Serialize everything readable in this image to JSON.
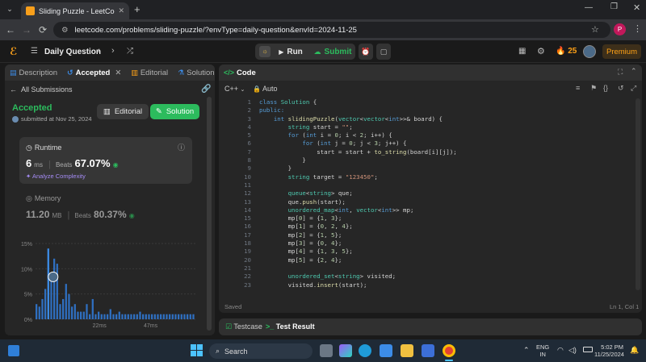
{
  "browser": {
    "tab_title": "Sliding Puzzle - LeetCode",
    "url": "leetcode.com/problems/sliding-puzzle/?envType=daily-question&envId=2024-11-25",
    "profile_initial": "P"
  },
  "header": {
    "daily_question": "Daily Question",
    "run": "Run",
    "submit": "Submit",
    "streak": "25",
    "premium": "Premium"
  },
  "left": {
    "tabs": [
      "Description",
      "Accepted",
      "Editorial",
      "Solutions"
    ],
    "all_submissions": "All Submissions",
    "status": "Accepted",
    "submitted": "submitted at Nov 25, 2024",
    "editorial_btn": "Editorial",
    "solution_btn": "Solution",
    "runtime_label": "Runtime",
    "runtime_value": "6",
    "runtime_unit": "ms",
    "runtime_beats_label": "Beats",
    "runtime_beats": "67.07%",
    "analyze": "Analyze Complexity",
    "memory_label": "Memory",
    "memory_value": "11.20",
    "memory_unit": "MB",
    "memory_beats_label": "Beats",
    "memory_beats": "80.37%"
  },
  "chart_data": {
    "type": "bar",
    "yticks": [
      "15%",
      "10%",
      "5%",
      "0%"
    ],
    "xticks": [
      "22ms",
      "47ms"
    ],
    "ylim": [
      0,
      15
    ],
    "values": [
      3,
      2.5,
      4,
      6,
      14,
      9,
      12,
      11,
      3,
      4,
      7,
      5,
      2.5,
      3,
      1.5,
      1.5,
      1.5,
      3,
      1,
      4,
      1,
      1.5,
      1,
      1,
      1,
      2,
      1,
      1,
      1.5,
      1,
      1,
      1,
      1,
      1,
      1,
      1.5,
      1,
      1,
      1,
      1,
      1,
      1,
      1,
      1,
      1,
      1,
      1,
      1,
      1,
      1,
      1,
      1,
      1,
      1
    ],
    "highlight_index": 4
  },
  "code": {
    "title": "Code",
    "language": "C++",
    "mode": "Auto",
    "lines": [
      [
        "kw",
        "class ",
        "ty",
        "Solution",
        "",
        " {"
      ],
      [
        "kw",
        "public:"
      ],
      [
        "",
        "    ",
        "kw",
        "int ",
        "fn",
        "slidingPuzzle",
        "",
        "(",
        "ty",
        "vector",
        "",
        "<",
        "ty",
        "vector",
        "",
        "<",
        "kw",
        "int",
        "",
        ">>& board) {"
      ],
      [
        "",
        "        ",
        "ty",
        "string",
        "",
        " start = ",
        "st",
        "\"\"",
        "",
        ";"
      ],
      [
        "",
        "        ",
        "kw",
        "for ",
        "",
        "(",
        "kw",
        "int",
        "",
        " i = ",
        "nm",
        "0",
        "",
        "; i < ",
        "nm",
        "2",
        "",
        "; i++) {"
      ],
      [
        "",
        "            ",
        "kw",
        "for ",
        "",
        "(",
        "kw",
        "int",
        "",
        " j = ",
        "nm",
        "0",
        "",
        "; j < ",
        "nm",
        "3",
        "",
        "; j++) {"
      ],
      [
        "",
        "                start = start + ",
        "fn",
        "to_string",
        "",
        "(board[i][j]);"
      ],
      [
        "",
        "            }"
      ],
      [
        "",
        "        }"
      ],
      [
        "",
        "        ",
        "ty",
        "string",
        "",
        " target = ",
        "st",
        "\"123450\"",
        "",
        ";"
      ],
      [
        "",
        ""
      ],
      [
        "",
        "        ",
        "ty",
        "queue",
        "",
        "<",
        "ty",
        "string",
        "",
        "> que;"
      ],
      [
        "",
        "        que.",
        "fn",
        "push",
        "",
        "(start);"
      ],
      [
        "",
        "        ",
        "ty",
        "unordered_map",
        "",
        "<",
        "kw",
        "int",
        "",
        ", ",
        "ty",
        "vector",
        "",
        "<",
        "kw",
        "int",
        "",
        ">> mp;"
      ],
      [
        "",
        "        mp[",
        "nm",
        "0",
        "",
        "] = {",
        "nm",
        "1",
        "",
        ", ",
        "nm",
        "3",
        "",
        "};"
      ],
      [
        "",
        "        mp[",
        "nm",
        "1",
        "",
        "] = {",
        "nm",
        "0",
        "",
        ", ",
        "nm",
        "2",
        "",
        ", ",
        "nm",
        "4",
        "",
        "};"
      ],
      [
        "",
        "        mp[",
        "nm",
        "2",
        "",
        "] = {",
        "nm",
        "1",
        "",
        ", ",
        "nm",
        "5",
        "",
        "};"
      ],
      [
        "",
        "        mp[",
        "nm",
        "3",
        "",
        "] = {",
        "nm",
        "0",
        "",
        ", ",
        "nm",
        "4",
        "",
        "};"
      ],
      [
        "",
        "        mp[",
        "nm",
        "4",
        "",
        "] = {",
        "nm",
        "1",
        "",
        ", ",
        "nm",
        "3",
        "",
        ", ",
        "nm",
        "5",
        "",
        "};"
      ],
      [
        "",
        "        mp[",
        "nm",
        "5",
        "",
        "] = {",
        "nm",
        "2",
        "",
        ", ",
        "nm",
        "4",
        "",
        "};"
      ],
      [
        "",
        ""
      ],
      [
        "",
        "        ",
        "ty",
        "unordered_set",
        "",
        "<",
        "ty",
        "string",
        "",
        "> visited;"
      ],
      [
        "",
        "        visited.",
        "fn",
        "insert",
        "",
        "(start);"
      ]
    ],
    "saved": "Saved",
    "cursor": "Ln 1, Col 1"
  },
  "bottom": {
    "testcase": "Testcase",
    "result": "Test Result"
  },
  "taskbar": {
    "search": "Search",
    "lang1": "ENG",
    "lang2": "IN",
    "time": "5:02 PM",
    "date": "11/25/2024"
  },
  "colors": {
    "accepted": "#2cbb5d",
    "accent_blue": "#3c8ce7",
    "keyword": "#569cd6",
    "type": "#4ec9b0",
    "string": "#ce9178",
    "number": "#b5cea8",
    "func": "#dcdcaa"
  }
}
